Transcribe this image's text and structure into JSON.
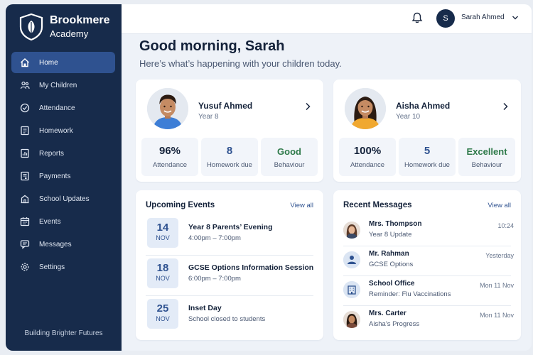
{
  "brand": {
    "name": "Brookmere",
    "sub": "Academy",
    "tagline": "Building Brighter Futures"
  },
  "nav": [
    {
      "label": "Home",
      "icon": "home-icon",
      "active": true
    },
    {
      "label": "My Children",
      "icon": "children-icon"
    },
    {
      "label": "Attendance",
      "icon": "attendance-icon"
    },
    {
      "label": "Homework",
      "icon": "homework-icon"
    },
    {
      "label": "Reports",
      "icon": "reports-icon"
    },
    {
      "label": "Payments",
      "icon": "payments-icon"
    },
    {
      "label": "School Updates",
      "icon": "school-icon"
    },
    {
      "label": "Events",
      "icon": "calendar-icon"
    },
    {
      "label": "Messages",
      "icon": "messages-icon"
    },
    {
      "label": "Settings",
      "icon": "gear-icon"
    }
  ],
  "topbar": {
    "avatar_initial": "S",
    "user_name": "Sarah Ahmed"
  },
  "greeting": {
    "title": "Good morning, Sarah",
    "subtitle": "Here’s what’s happening with your children today."
  },
  "children": [
    {
      "name": "Yusuf Ahmed",
      "year": "Year 8",
      "stats": [
        {
          "value": "96%",
          "label": "Attendance"
        },
        {
          "value": "8",
          "label": "Homework due"
        },
        {
          "value": "Good",
          "label": "Behaviour"
        }
      ]
    },
    {
      "name": "Aisha Ahmed",
      "year": "Year 10",
      "stats": [
        {
          "value": "100%",
          "label": "Attendance"
        },
        {
          "value": "5",
          "label": "Homework due"
        },
        {
          "value": "Excellent",
          "label": "Behaviour"
        }
      ]
    }
  ],
  "events": {
    "title": "Upcoming Events",
    "view_all": "View all",
    "items": [
      {
        "day": "14",
        "month": "NOV",
        "title": "Year 8 Parents’ Evening",
        "sub": "4:00pm – 7:00pm"
      },
      {
        "day": "18",
        "month": "NOV",
        "title": "GCSE Options Information Session",
        "sub": "6:00pm – 7:00pm"
      },
      {
        "day": "25",
        "month": "NOV",
        "title": "Inset Day",
        "sub": "School closed to students"
      }
    ]
  },
  "messages": {
    "title": "Recent Messages",
    "view_all": "View all",
    "items": [
      {
        "name": "Mrs. Thompson",
        "sub": "Year 8 Update",
        "time": "10:24"
      },
      {
        "name": "Mr. Rahman",
        "sub": "GCSE Options",
        "time": "Yesterday"
      },
      {
        "name": "School Office",
        "sub": "Reminder: Flu Vaccinations",
        "time": "Mon 11 Nov"
      },
      {
        "name": "Mrs. Carter",
        "sub": "Aisha’s Progress",
        "time": "Mon 11 Nov"
      }
    ]
  },
  "colors": {
    "sidebar": "#172b4b",
    "active": "#2f5290",
    "accent": "#2f5290",
    "good": "#2f7a4a"
  }
}
